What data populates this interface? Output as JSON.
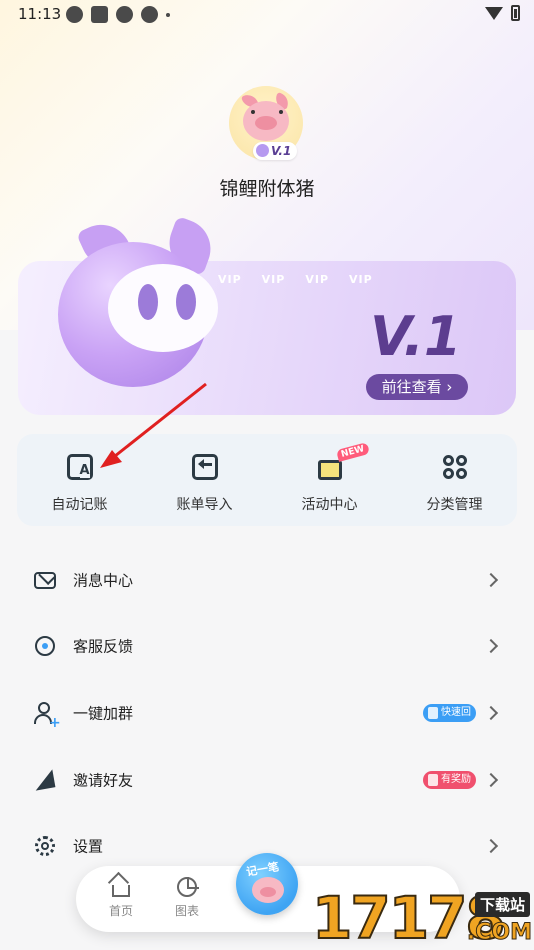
{
  "status_bar": {
    "time": "11:13"
  },
  "profile": {
    "username": "锦鲤附体猪",
    "level": "V.1"
  },
  "vip_card": {
    "strip": [
      "VIP",
      "VIP",
      "VIP",
      "VIP"
    ],
    "level_text": "V.1",
    "button_label": "前往查看 ›"
  },
  "quick_actions": [
    {
      "label": "自动记账",
      "icon": "auto-bookkeeping-icon"
    },
    {
      "label": "账单导入",
      "icon": "bill-import-icon"
    },
    {
      "label": "活动中心",
      "icon": "gift-icon",
      "badge": "NEW"
    },
    {
      "label": "分类管理",
      "icon": "category-grid-icon"
    }
  ],
  "menu": [
    {
      "label": "消息中心",
      "icon": "mail-icon"
    },
    {
      "label": "客服反馈",
      "icon": "headset-icon"
    },
    {
      "label": "一键加群",
      "icon": "add-user-icon",
      "tag": "快速回"
    },
    {
      "label": "邀请好友",
      "icon": "send-icon",
      "tag": "有奖励"
    },
    {
      "label": "设置",
      "icon": "gear-icon"
    }
  ],
  "bottom_nav": {
    "home": "首页",
    "charts": "图表",
    "fab_label": "记一笔"
  },
  "watermark": {
    "number": "17178",
    "tag": "下载站",
    "suffix": ".COM"
  },
  "colors": {
    "accent": "#6b4aa0",
    "blue": "#3b9ef5",
    "red": "#f0506e",
    "card": "#eef3f8"
  }
}
